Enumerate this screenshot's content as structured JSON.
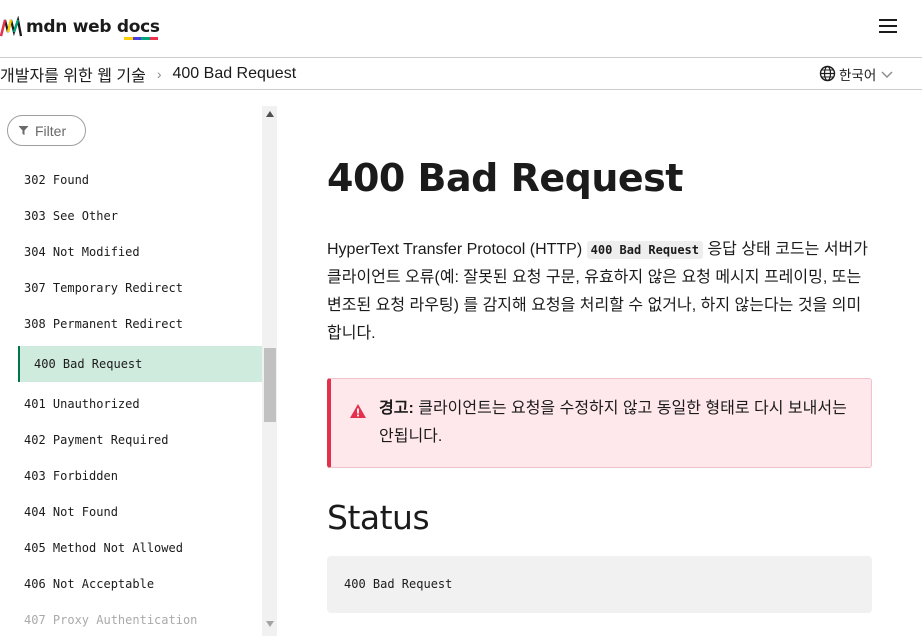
{
  "header": {
    "logo_text": "mdn web docs",
    "logo_underline_colors": [
      "#ffcf00",
      "#4c3ce0",
      "#00a77c",
      "#ef2f4e"
    ],
    "menu_icon": "hamburger-icon"
  },
  "breadcrumb": {
    "parent": "개발자를 위한 웹 기술",
    "separator": "›",
    "current": "400 Bad Request"
  },
  "language": {
    "icon": "globe-icon",
    "label": "한국어"
  },
  "sidebar": {
    "filter_placeholder": "Filter",
    "items": [
      {
        "label": "302 Found"
      },
      {
        "label": "303 See Other"
      },
      {
        "label": "304 Not Modified"
      },
      {
        "label": "307 Temporary Redirect"
      },
      {
        "label": "308 Permanent Redirect"
      },
      {
        "label": "400 Bad Request",
        "active": true
      },
      {
        "label": "401 Unauthorized"
      },
      {
        "label": "402 Payment Required"
      },
      {
        "label": "403 Forbidden"
      },
      {
        "label": "404 Not Found"
      },
      {
        "label": "405 Method Not Allowed"
      },
      {
        "label": "406 Not Acceptable"
      },
      {
        "label": "407 Proxy Authentication"
      }
    ]
  },
  "article": {
    "title": "400 Bad Request",
    "intro_before": "HyperText Transfer Protocol (HTTP) ",
    "intro_code": "400 Bad Request",
    "intro_after": " 응답 상태 코드는 서버가 클라이언트 오류(예: 잘못된 요청 구문, 유효하지 않은 요청 메시지 프레이밍, 또는 변조된 요청 라우팅) 를 감지해 요청을 처리할 수 없거나, 하지 않는다는 것을 의미합니다.",
    "warning_label": "경고:",
    "warning_text": " 클라이언트는 요청을 수정하지 않고 동일한 형태로 다시 보내서는 안됩니다.",
    "status_heading": "Status",
    "status_code": "400 Bad Request"
  },
  "colors": {
    "accent_active_bg": "#cfebde",
    "accent_active_border": "#00754a",
    "warning_bg": "#ffe8ec",
    "warning_border": "#e2304d"
  }
}
